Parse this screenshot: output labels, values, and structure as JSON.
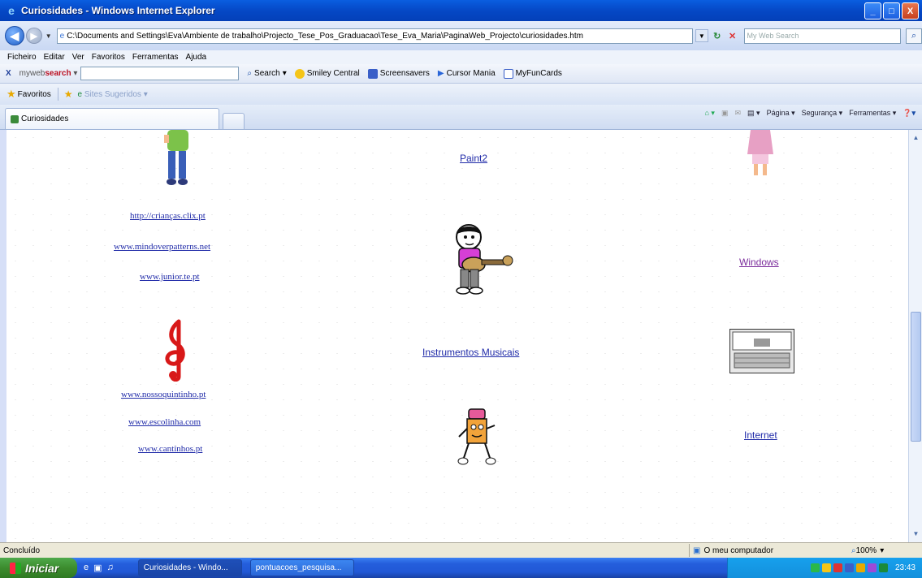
{
  "window": {
    "title": "Curiosidades - Windows Internet Explorer",
    "minimize_label": "_",
    "maximize_label": "□",
    "close_label": "X"
  },
  "address_bar": {
    "back_icon": "back-arrow-icon",
    "url": "C:\\Documents and Settings\\Eva\\Ambiente de trabalho\\Projecto_Tese_Pos_Graduacao\\Tese_Eva_Maria\\PaginaWeb_Projecto\\curiosidades.htm",
    "search_placeholder": "My Web Search"
  },
  "menu": [
    "Ficheiro",
    "Editar",
    "Ver",
    "Favoritos",
    "Ferramentas",
    "Ajuda"
  ],
  "search_toolbar": {
    "brand_prefix": "myweb",
    "brand_bold": "search",
    "search_label": "Search",
    "smiley_label": "Smiley Central",
    "screensavers_label": "Screensavers",
    "cursor_label": "Cursor Mania",
    "funcards_label": "MyFunCards"
  },
  "favorites_bar": {
    "favorites_label": "Favoritos",
    "suggested_label": "Sites Sugeridos"
  },
  "tab": {
    "title": "Curiosidades"
  },
  "command_bar": {
    "page_label": "Página",
    "security_label": "Segurança",
    "tools_label": "Ferramentas"
  },
  "content": {
    "left_links": [
      "http://crianças.clix.pt",
      "www.mindoverpatterns.net",
      "www.junior.te.pt"
    ],
    "left_links_2": [
      "www.nossoquintinho.pt",
      "www.escolinha.com",
      "www.cantinhos.pt"
    ],
    "center_links": {
      "paint": "Paint2",
      "instruments": "Instrumentos Musicais"
    },
    "right_links": {
      "windows": "Windows",
      "internet": "Internet"
    }
  },
  "status_bar": {
    "status": "Concluído",
    "zone": "O meu computador",
    "zoom": "100%"
  },
  "taskbar": {
    "start_label": "Iniciar",
    "tasks": [
      "Curiosidades - Windo...",
      "pontuacoes_pesquisa..."
    ],
    "clock": "23:43"
  }
}
